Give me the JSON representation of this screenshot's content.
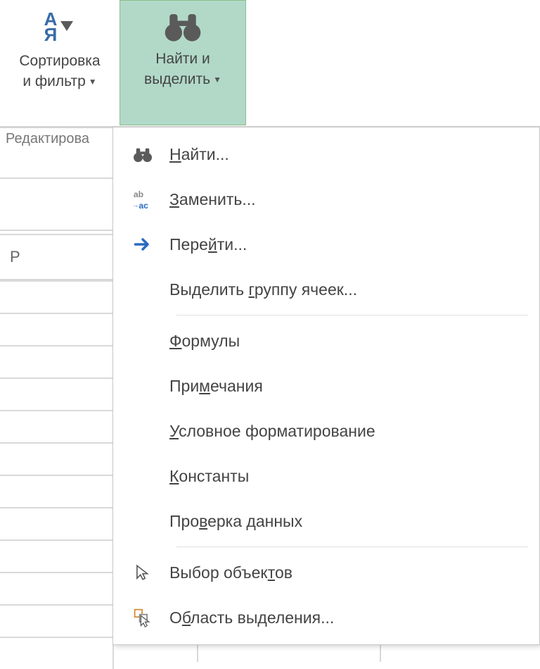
{
  "ribbon": {
    "sort_filter": {
      "line1": "Сортировка",
      "line2": "и фильтр"
    },
    "find_select": {
      "line1": "Найти и",
      "line2": "выделить"
    },
    "group_label": "Редактирова"
  },
  "grid": {
    "col_letter": "P"
  },
  "menu": {
    "find": "айти...",
    "find_u": "Н",
    "replace": "аменить...",
    "replace_u": "З",
    "goto": "ти...",
    "goto_pre": "Пере",
    "goto_u": "й",
    "goto_special_pre": "Выделить ",
    "goto_special_u": "г",
    "goto_special_post": "руппу ячеек...",
    "formulas_u": "Ф",
    "formulas": "ормулы",
    "comments_pre": "При",
    "comments_u": "м",
    "comments_post": "ечания",
    "cond_u": "У",
    "cond": "словное форматирование",
    "const_u": "К",
    "const": "онстанты",
    "dv_pre": "Про",
    "dv_u": "в",
    "dv_post": "ерка данных",
    "sel_obj_pre": "Выбор объек",
    "sel_obj_u": "т",
    "sel_obj_post": "ов",
    "sel_pane_pre": "О",
    "sel_pane_u": "б",
    "sel_pane_post": "ласть выделения..."
  }
}
